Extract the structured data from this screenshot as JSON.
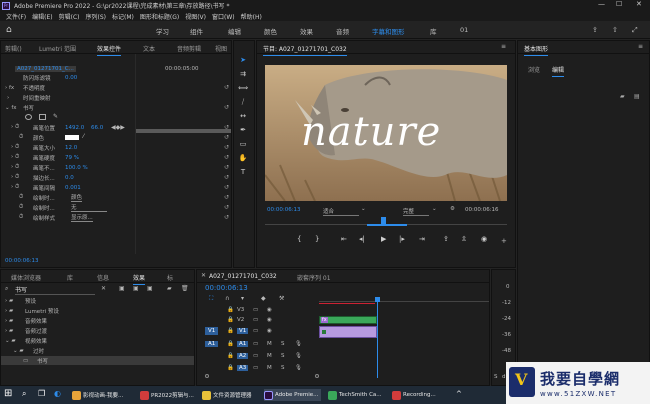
{
  "title_bar": {
    "title": "Adobe Premiere Pro 2022 - G:\\pr2022课程\\完成素材\\第三章\\存放路径\\书写 *",
    "logo": "Pr"
  },
  "menu": [
    "文件(F)",
    "编辑(E)",
    "剪辑(C)",
    "序列(S)",
    "标记(M)",
    "图形和标题(G)",
    "视图(V)",
    "窗口(W)",
    "帮助(H)"
  ],
  "workspaces": [
    "学习",
    "组件",
    "编辑",
    "颜色",
    "效果",
    "音频",
    "字幕和图形",
    "库",
    "01"
  ],
  "active_workspace": "字幕和图形",
  "source_panel": {
    "tabs": [
      "剪辑()",
      "Lumetri 范围",
      "效果控件",
      "文本",
      "音频剪辑",
      "视图"
    ],
    "clip_name": "A027_01271701_C...",
    "timecode": "00:00:05:00",
    "rows": [
      {
        "label": "防闪烁滤镜",
        "value": "0.00"
      },
      {
        "label": "不透明度",
        "value": ""
      },
      {
        "label": "时间重映射",
        "value": ""
      },
      {
        "label": "书写",
        "value": ""
      },
      {
        "label": "画笔位置",
        "value": "1492.0",
        "value2": "66.0"
      },
      {
        "label": "颜色",
        "value": ""
      },
      {
        "label": "画笔大小",
        "value": "12.0"
      },
      {
        "label": "画笔硬度",
        "value": "79 %"
      },
      {
        "label": "画笔不...",
        "value": "100.0 %"
      },
      {
        "label": "描边长...",
        "value": "0.0"
      },
      {
        "label": "画笔间隔",
        "value": "0.001"
      },
      {
        "label": "绘制时...",
        "value": "颜色"
      },
      {
        "label": "绘制时...",
        "value": "无"
      },
      {
        "label": "绘制样式",
        "value": "显示原..."
      }
    ],
    "footer_timecode": "00:00:06:13"
  },
  "program_panel": {
    "tab": "节目: A027_01271701_C032",
    "overlay_text": "nature",
    "timecode_left": "00:00:06:13",
    "fit": "适合",
    "quality": "完整",
    "timecode_right": "00:00:06:16"
  },
  "essential_graphics": {
    "title": "基本图形",
    "tabs": [
      "浏览",
      "编辑"
    ],
    "active_tab": "编辑"
  },
  "project_panel": {
    "tabs": [
      "媒体浏览器",
      "库",
      "信息",
      "效果",
      "标"
    ],
    "active_tab": "效果",
    "search": "书写",
    "items": [
      "预设",
      "Lumetri 预设",
      "音频效果",
      "音频过渡",
      "视频效果",
      "过时",
      "书写"
    ]
  },
  "timeline": {
    "tabs": [
      "A027_01271701_C032",
      "嵌套序列 01"
    ],
    "timecode": "00:00:06:13",
    "tracks": [
      "V3",
      "V2",
      "V1",
      "A1",
      "A2",
      "A3"
    ],
    "left_tracks": [
      "V1",
      "A1"
    ],
    "db_labels": [
      "0",
      "-12",
      "-24",
      "-36",
      "-48",
      "dB"
    ],
    "clip_label": "fx"
  },
  "taskbar": {
    "items": [
      "影视动画-我要...",
      "PR2022剪辑与...",
      "文件资源管理器",
      "Adobe Premie...",
      "TechSmith Ca...",
      "Recording..."
    ],
    "active": "Adobe Premie..."
  },
  "watermark": {
    "text": "我要自學網",
    "url": "www.51ZXW.NET"
  }
}
